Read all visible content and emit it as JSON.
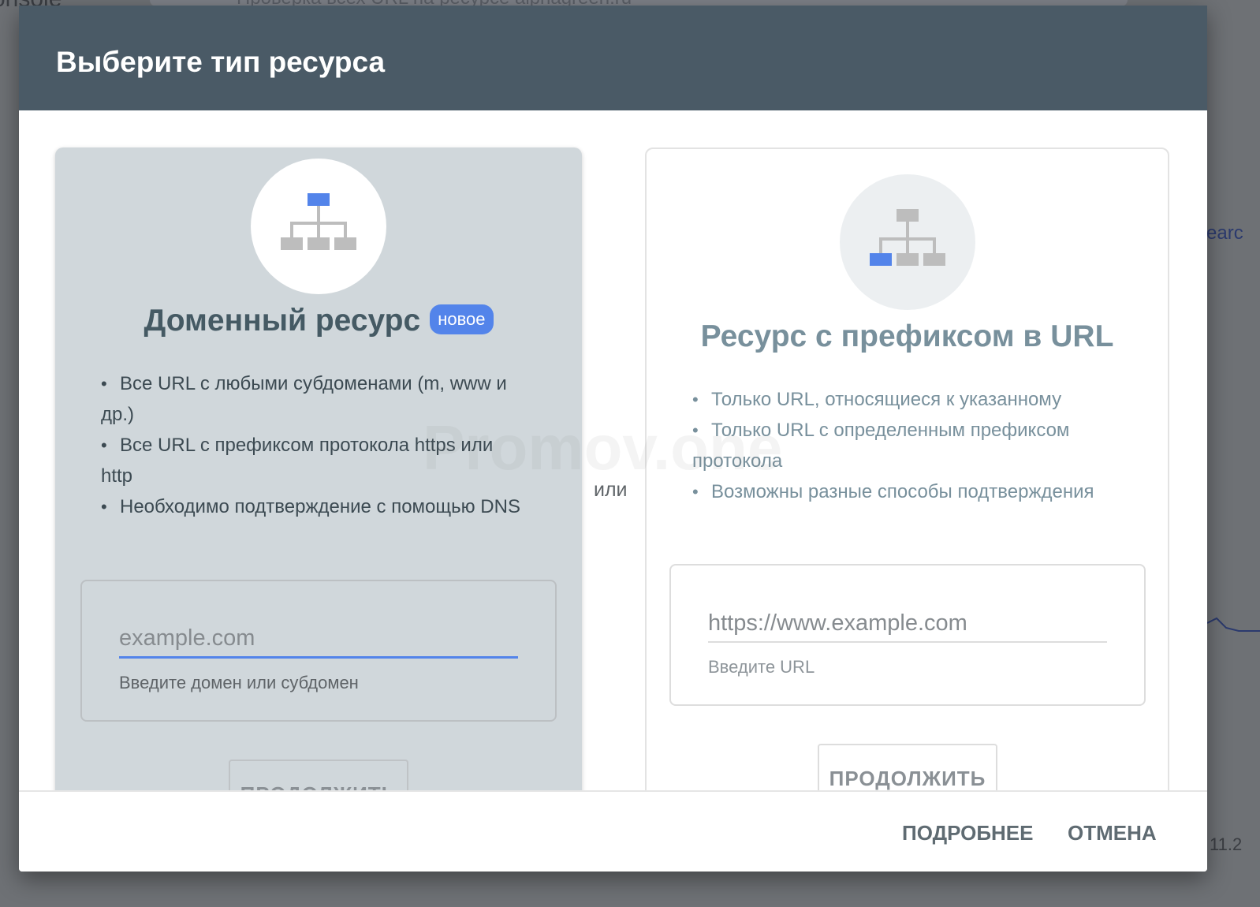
{
  "background": {
    "app_name_fragment": "onsole",
    "search_text": "Проверка всех URL на ресурсе alphagreen.ru",
    "side_fragment": "earc",
    "axis_fragment": "11.2"
  },
  "dialog": {
    "title": "Выберите тип ресурса",
    "separator": "или",
    "domain": {
      "title": "Доменный ресурс",
      "badge": "новое",
      "bullets": [
        "Все URL с любыми субдоменами (m, www и др.)",
        "Все URL с префиксом протокола https или http",
        "Необходимо подтверждение с помощью DNS"
      ],
      "input_placeholder": "example.com",
      "input_value": "",
      "hint": "Введите домен или субдомен",
      "continue_label": "ПРОДОЛЖИТЬ",
      "icon": "sitemap-icon-top-highlighted"
    },
    "prefix": {
      "title": "Ресурс с префиксом в URL",
      "bullets": [
        "Только URL, относящиеся к указанному",
        "Только URL с определенным префиксом протокола",
        "Возможны разные способы подтверждения"
      ],
      "input_placeholder": "https://www.example.com",
      "input_value": "",
      "hint": "Введите URL",
      "continue_label": "ПРОДОЛЖИТЬ",
      "icon": "sitemap-icon-leaf-highlighted"
    },
    "footer": {
      "learn_more": "ПОДРОБНЕЕ",
      "cancel": "ОТМЕНА"
    },
    "watermark": "Promov.one",
    "colors": {
      "header": "#4a5a66",
      "accent": "#5384ea",
      "selected_card": "#d0d7db"
    }
  }
}
